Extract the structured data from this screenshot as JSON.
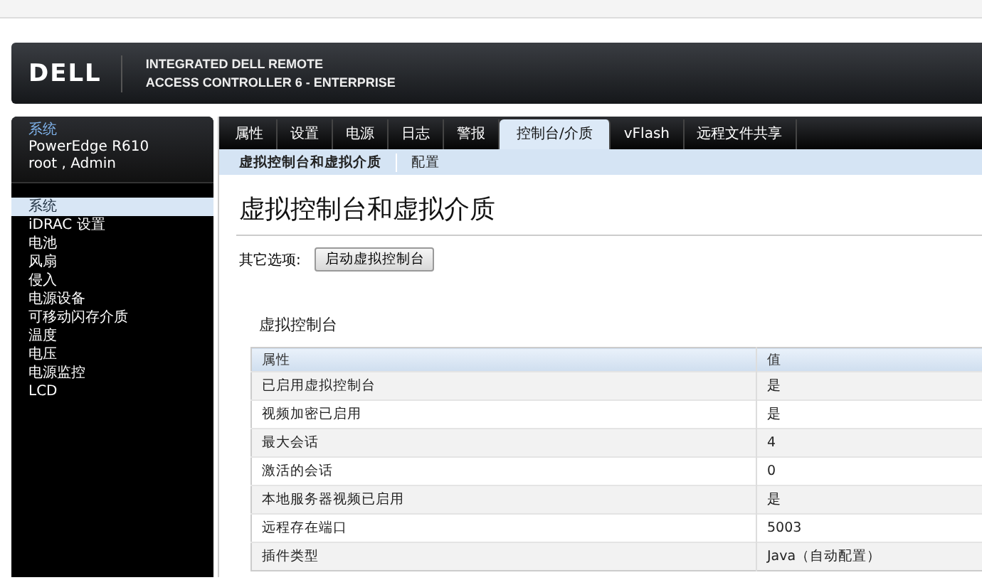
{
  "header": {
    "logo": "DELL",
    "title_line_1": "INTEGRATED DELL REMOTE",
    "title_line_2": "ACCESS CONTROLLER 6 - ENTERPRISE"
  },
  "sidebar": {
    "heading": "系统",
    "model": "PowerEdge R610",
    "user": "root , Admin",
    "items": [
      {
        "label": "系统",
        "selected": true
      },
      {
        "label": "iDRAC 设置",
        "selected": false
      },
      {
        "label": "电池",
        "selected": false
      },
      {
        "label": "风扇",
        "selected": false
      },
      {
        "label": "侵入",
        "selected": false
      },
      {
        "label": "电源设备",
        "selected": false
      },
      {
        "label": "可移动闪存介质",
        "selected": false
      },
      {
        "label": "温度",
        "selected": false
      },
      {
        "label": "电压",
        "selected": false
      },
      {
        "label": "电源监控",
        "selected": false
      },
      {
        "label": "LCD",
        "selected": false
      }
    ]
  },
  "tabs": [
    {
      "label": "属性",
      "selected": false
    },
    {
      "label": "设置",
      "selected": false
    },
    {
      "label": "电源",
      "selected": false
    },
    {
      "label": "日志",
      "selected": false
    },
    {
      "label": "警报",
      "selected": false
    },
    {
      "label": "控制台/介质",
      "selected": true
    },
    {
      "label": "vFlash",
      "selected": false
    },
    {
      "label": "远程文件共享",
      "selected": false
    }
  ],
  "subtabs": [
    {
      "label": "虚拟控制台和虚拟介质",
      "selected": true
    },
    {
      "label": "配置",
      "selected": false
    }
  ],
  "page_title": "虚拟控制台和虚拟介质",
  "other_options": {
    "label": "其它选项:",
    "button": "启动虚拟控制台"
  },
  "section": {
    "title": "虚拟控制台",
    "table": {
      "columns": [
        "属性",
        "值"
      ],
      "rows": [
        [
          "已启用虚拟控制台",
          "是"
        ],
        [
          "视频加密已启用",
          "是"
        ],
        [
          "最大会话",
          "4"
        ],
        [
          "激活的会话",
          "0"
        ],
        [
          "本地服务器视频已启用",
          "是"
        ],
        [
          "远程存在端口",
          "5003"
        ],
        [
          "插件类型",
          "Java（自动配置）"
        ]
      ]
    }
  }
}
